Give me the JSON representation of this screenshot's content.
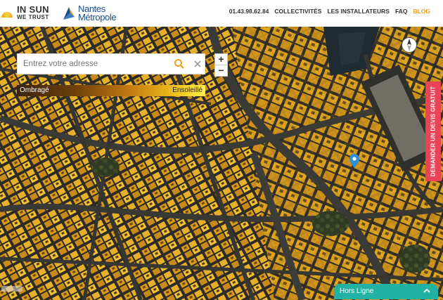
{
  "header": {
    "logo_line1": "IN SUN",
    "logo_line2": "WE TRUST",
    "partner_line1": "Nantes",
    "partner_line2": "Métropole",
    "nav": {
      "phone": "01.43.98.62.84",
      "collectivites": "COLLECTIVITÉS",
      "installateurs": "LES INSTALLATEURS",
      "faq": "FAQ",
      "blog": "BLOG"
    }
  },
  "search": {
    "placeholder": "Entrez votre adresse",
    "value": ""
  },
  "zoom": {
    "in": "+",
    "out": "−"
  },
  "legend": {
    "left": "Ombragé",
    "right": "Ensoleillé"
  },
  "side_button": "DEMANDER UN DEVIS GRATUIT",
  "status": {
    "label": "Hors Ligne"
  },
  "icons": [
    "sun-logo-icon",
    "nantes-logo-icon",
    "search-icon",
    "close-icon",
    "compass-icon",
    "location-pin-icon",
    "chevron-up-icon"
  ],
  "colors": {
    "accent": "#f0a020",
    "status": "#22b2a3",
    "cta": "#e94356",
    "partner": "#1b4e8a"
  }
}
